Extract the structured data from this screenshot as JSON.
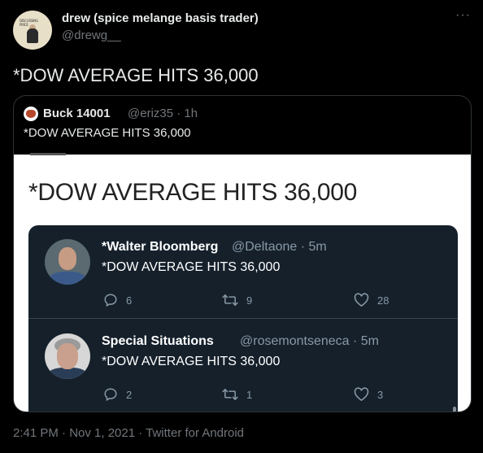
{
  "author": {
    "name": "drew (spice melange basis trader)",
    "handle": "@drewg__",
    "avatar_text": "DISCUSSING PRICE"
  },
  "tweet": {
    "text": "*DOW AVERAGE HITS 36,000",
    "more_icon": "more-dots-icon"
  },
  "quoted": {
    "name": "Buck 14001",
    "meta": "@eriz35 · 1h",
    "text": "*DOW AVERAGE HITS 36,000",
    "image": {
      "headline": "*DOW AVERAGE HITS 36,000",
      "embedded_tweets": [
        {
          "name": "*Walter Bloomberg",
          "meta": "@Deltaone · 5m",
          "text": "*DOW AVERAGE HITS 36,000",
          "replies": "6",
          "retweets": "9",
          "likes": "28"
        },
        {
          "name": "Special Situations",
          "meta": "@rosemontseneca · 5m",
          "text": "*DOW AVERAGE HITS 36,000",
          "replies": "2",
          "retweets": "1",
          "likes": "3"
        }
      ]
    }
  },
  "footer": {
    "timestamp": "2:41 PM · Nov 1, 2021 · Twitter for Android"
  },
  "colors": {
    "background": "#000000",
    "embed_bg": "#15202b",
    "muted": "#71767b"
  }
}
